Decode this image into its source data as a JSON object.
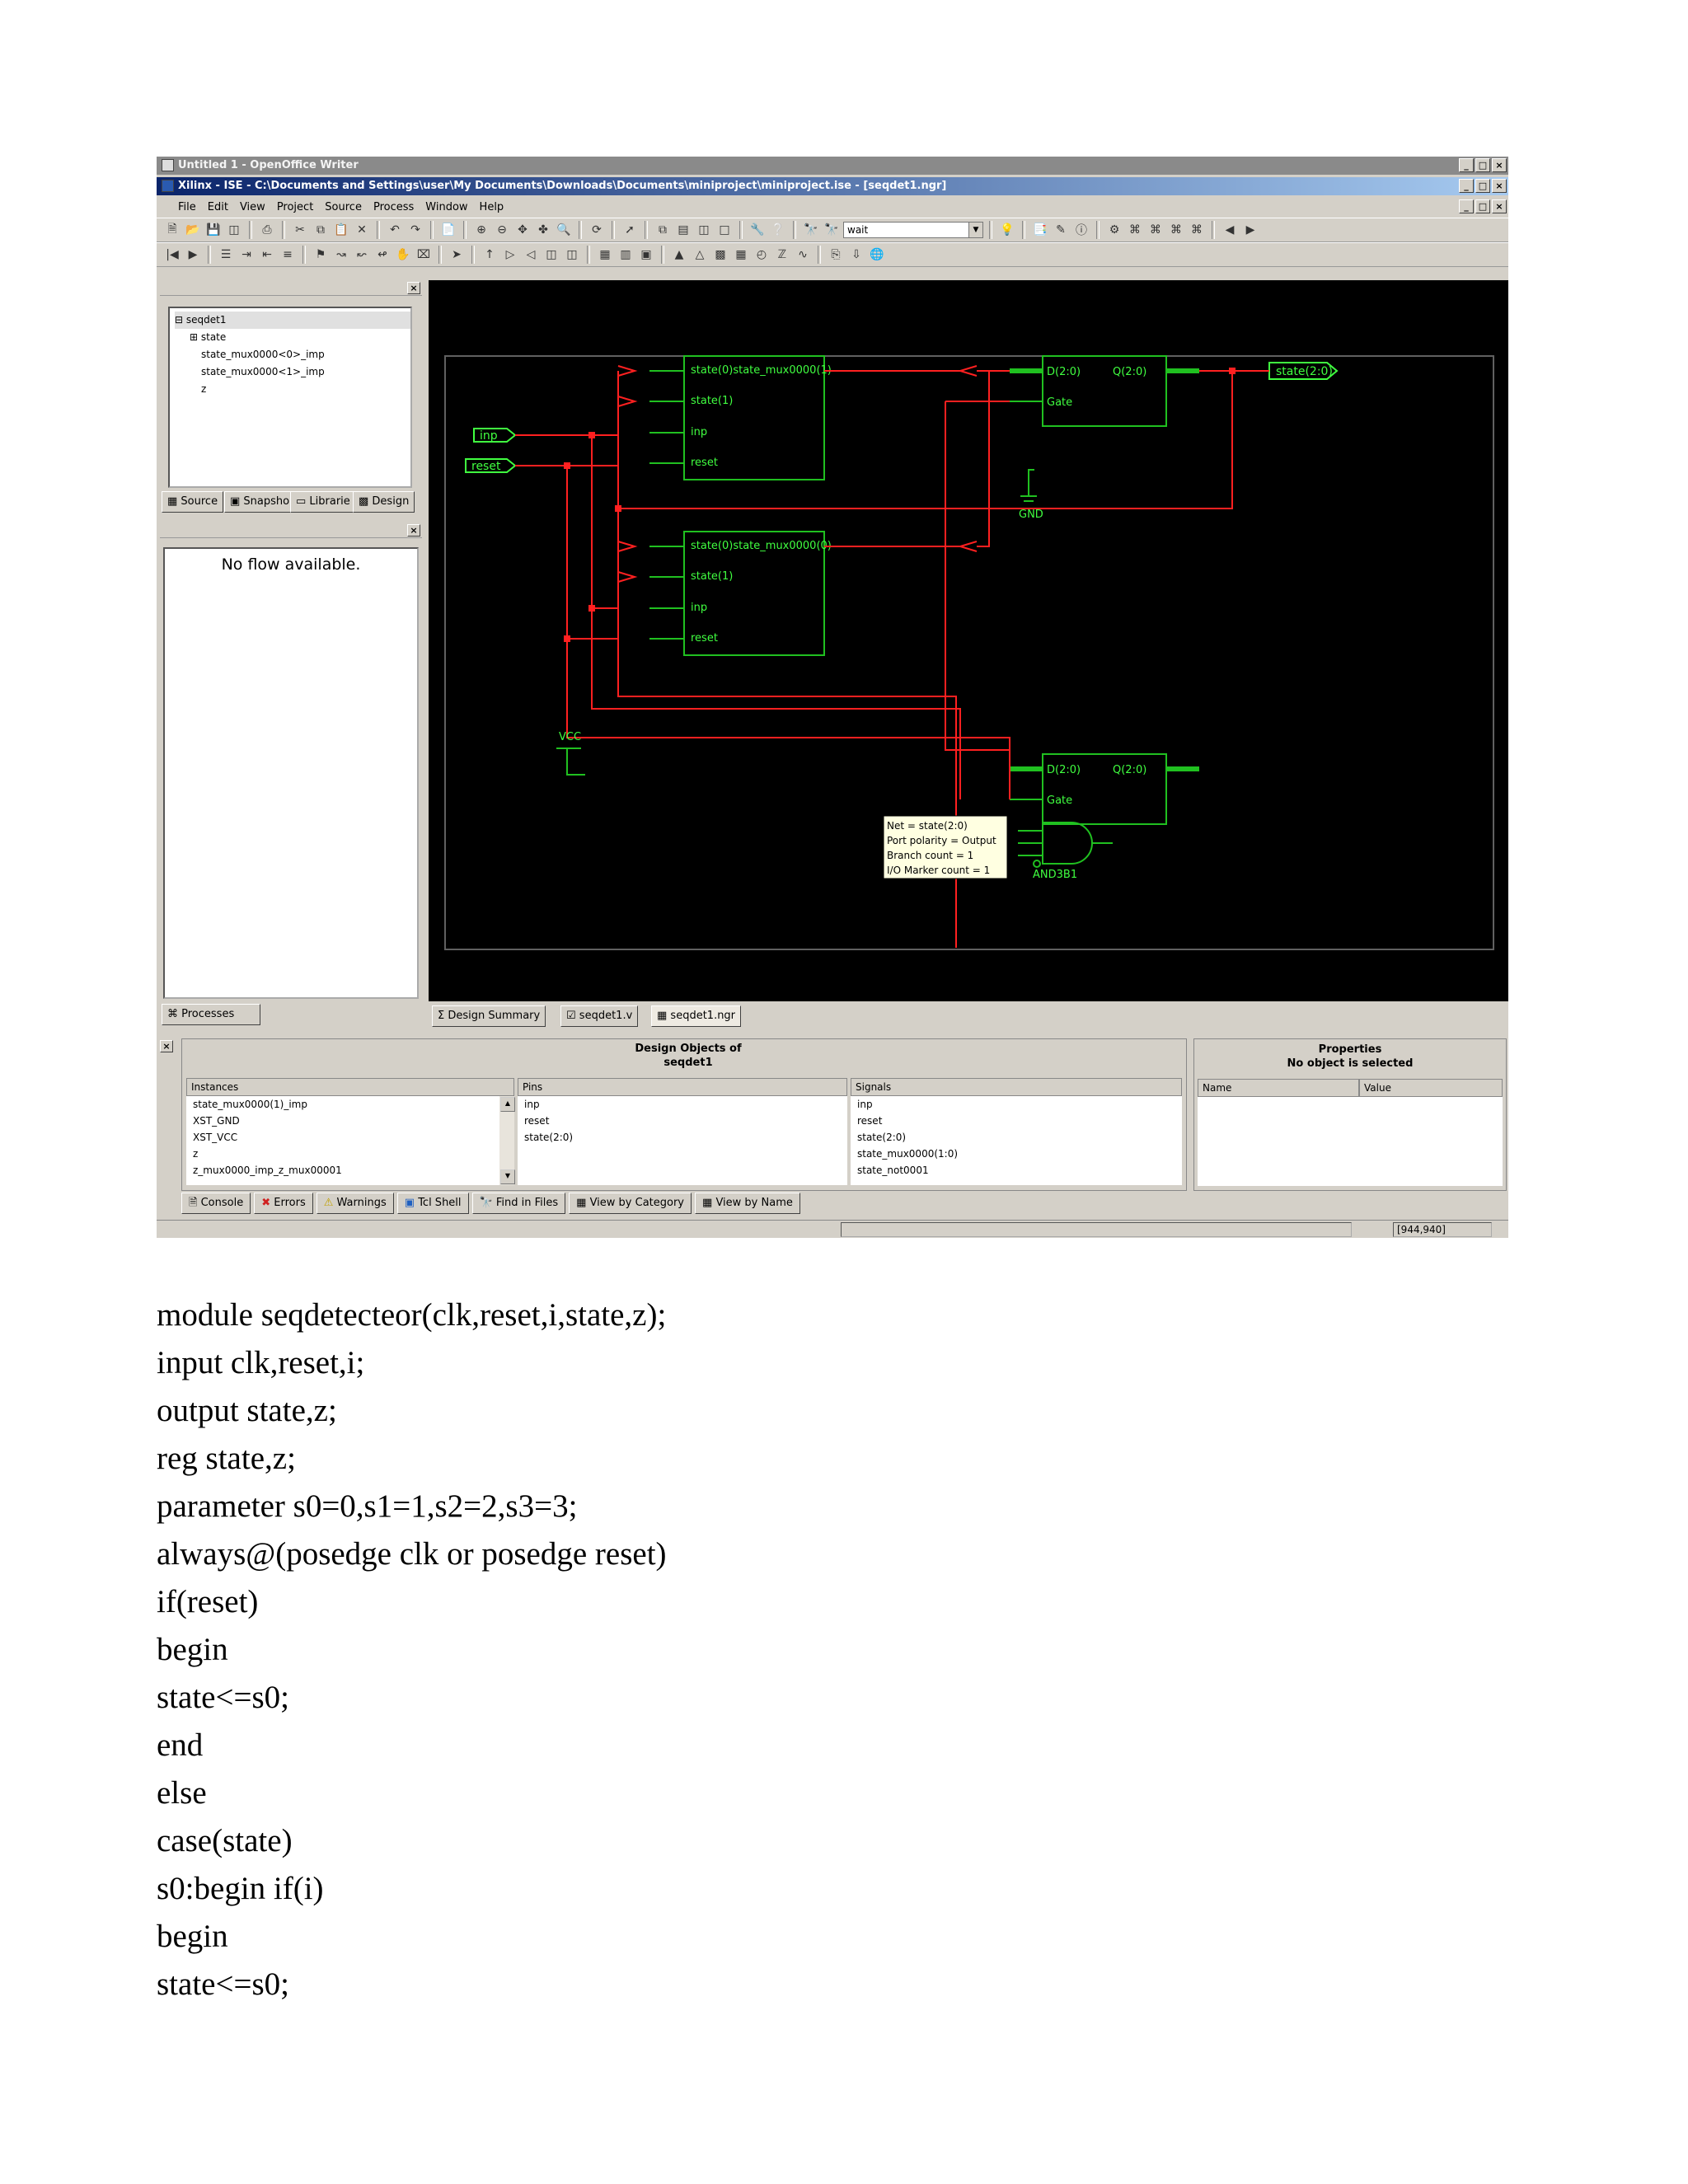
{
  "outer_window": {
    "title": "Untitled 1 - OpenOffice Writer"
  },
  "ise_window": {
    "title": "Xilinx - ISE - C:\\Documents and Settings\\user\\My Documents\\Downloads\\Documents\\miniproject\\miniproject.ise - [seqdet1.ngr]"
  },
  "menu": [
    "File",
    "Edit",
    "View",
    "Project",
    "Source",
    "Process",
    "Window",
    "Help"
  ],
  "toolbar": {
    "search_value": "wait"
  },
  "sources_tree": [
    "seqdet1",
    "state",
    "state_mux0000<0>_imp",
    "state_mux0000<1>_imp",
    "z"
  ],
  "left_tabs": [
    "Source",
    "Snapsho",
    "Librarie",
    "Design"
  ],
  "process_panel": {
    "message": "No flow available.",
    "tab": "Processes"
  },
  "schematic": {
    "ports": {
      "inp": "inp",
      "reset": "reset",
      "state_out": "state(2:0)"
    },
    "block1": {
      "pins": [
        "state(0)state_mux0000(1)",
        "state(1)",
        "inp",
        "reset"
      ]
    },
    "block2": {
      "pins": [
        "state(0)state_mux0000(0)",
        "state(1)",
        "inp",
        "reset"
      ]
    },
    "latch1": {
      "d": "D(2:0)",
      "q": "Q(2:0)",
      "gate": "Gate"
    },
    "latch2": {
      "d": "D(2:0)",
      "q": "Q(2:0)",
      "gate": "Gate"
    },
    "gnd": "GND",
    "vcc": "VCC",
    "gate_label": "AND3B1",
    "tooltip": [
      "Net = state(2:0)",
      "Port polarity = Output",
      "Branch count = 1",
      "I/O Marker count = 1"
    ]
  },
  "editor_tabs": [
    "Design Summary",
    "seqdet1.v",
    "seqdet1.ngr"
  ],
  "design_objects": {
    "title_line1": "Design Objects of",
    "title_line2": "seqdet1",
    "instances_header": "Instances",
    "instances": [
      "state_mux0000(1)_imp",
      "XST_GND",
      "XST_VCC",
      "z",
      "z_mux0000_imp_z_mux00001"
    ],
    "pins_header": "Pins",
    "pins": [
      "inp",
      "reset",
      "state(2:0)"
    ],
    "signals_header": "Signals",
    "signals": [
      "inp",
      "reset",
      "state(2:0)",
      "state_mux0000(1:0)",
      "state_not0001"
    ]
  },
  "properties": {
    "title": "Properties",
    "subtitle": "No object is selected",
    "name_header": "Name",
    "value_header": "Value"
  },
  "bottom_tabs": [
    "Console",
    "Errors",
    "Warnings",
    "Tcl Shell",
    "Find in Files",
    "View by Category",
    "View by Name"
  ],
  "status": {
    "coords": "[944,940]"
  },
  "code_lines": [
    "module seqdetecteor(clk,reset,i,state,z);",
    "input clk,reset,i;",
    "output state,z;",
    "reg state,z;",
    "parameter s0=0,s1=1,s2=2,s3=3;",
    "always@(posedge clk or posedge reset)",
    "if(reset)",
    "begin",
    "state<=s0;",
    "end",
    "else",
    "case(state)",
    "s0:begin if(i)",
    "begin",
    "state<=s0;"
  ],
  "colors": {
    "wire_red": "#ff2020",
    "block_green": "#20c020",
    "label_green": "#40ff40",
    "canvas_bg": "#000000",
    "title_blue": "#0a246a"
  }
}
